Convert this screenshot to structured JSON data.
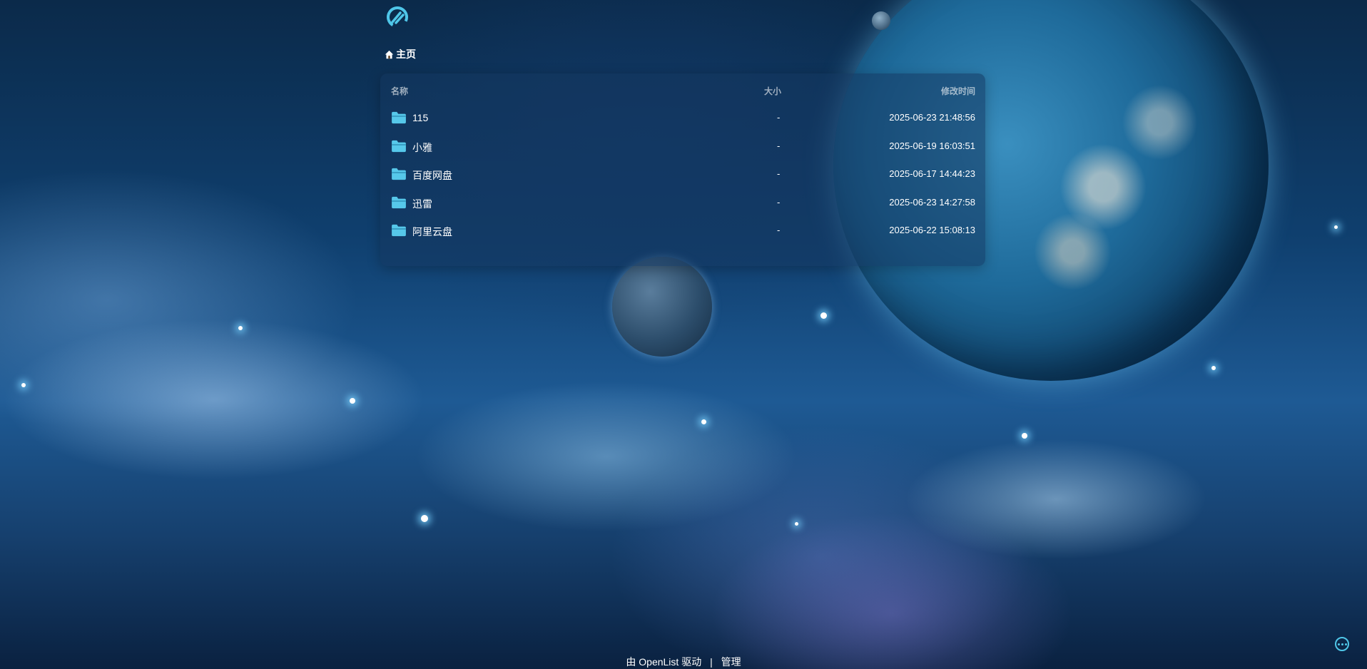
{
  "header": {
    "breadcrumb_home": "主页"
  },
  "table": {
    "col_name": "名称",
    "col_size": "大小",
    "col_modified": "修改时间",
    "rows": [
      {
        "name": "115",
        "size": "-",
        "modified": "2025-06-23 21:48:56"
      },
      {
        "name": "小雅",
        "size": "-",
        "modified": "2025-06-19 16:03:51"
      },
      {
        "name": "百度网盘",
        "size": "-",
        "modified": "2025-06-17 14:44:23"
      },
      {
        "name": "迅雷",
        "size": "-",
        "modified": "2025-06-23 14:27:58"
      },
      {
        "name": "阿里云盘",
        "size": "-",
        "modified": "2025-06-22 15:08:13"
      }
    ]
  },
  "footer": {
    "powered_by": "由 OpenList 驱动",
    "separator": "|",
    "admin": "管理"
  },
  "colors": {
    "accent": "#4fc6e8",
    "folder": "#56c8ea",
    "panel": "#14375f"
  }
}
